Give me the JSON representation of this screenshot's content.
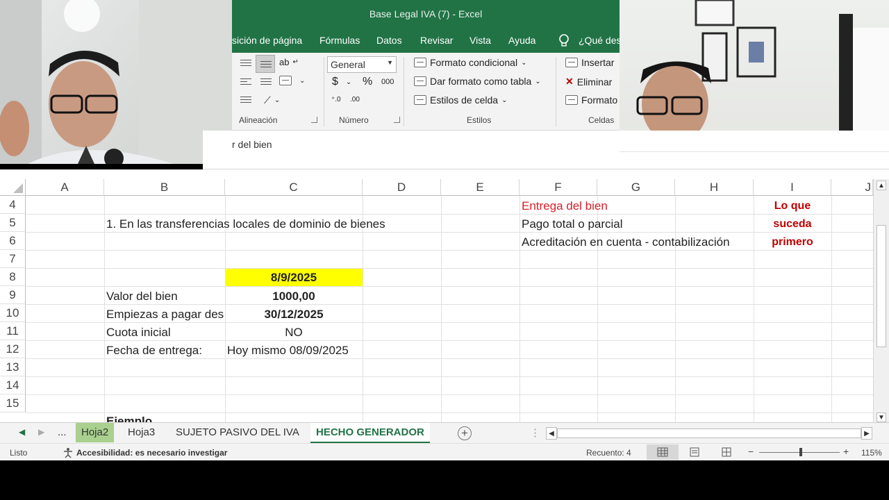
{
  "window": {
    "title": "Base Legal IVA (7)  -  Excel"
  },
  "menu_tabs": [
    "sición de página",
    "Fórmulas",
    "Datos",
    "Revisar",
    "Vista",
    "Ayuda"
  ],
  "tell_me": "¿Qué des",
  "ribbon": {
    "alignment_label": "Alineación",
    "number_label": "Número",
    "number_format": "General",
    "styles_label": "Estilos",
    "cells_label": "Celdas",
    "conditional_format": "Formato condicional",
    "format_as_table": "Dar formato como tabla",
    "cell_styles": "Estilos de celda",
    "insert": "Insertar",
    "delete": "Eliminar",
    "format": "Formato",
    "currency_symbol": "$",
    "percent_symbol": "%",
    "thousands_symbol": "000"
  },
  "formula_bar": {
    "content": "r del bien"
  },
  "columns": [
    "A",
    "B",
    "C",
    "D",
    "E",
    "F",
    "G",
    "H",
    "I",
    "J"
  ],
  "rows": [
    "4",
    "5",
    "6",
    "7",
    "8",
    "9",
    "10",
    "11",
    "12",
    "13",
    "14",
    "15"
  ],
  "cells": {
    "b5": "1. En las transferencias locales de dominio de bienes",
    "f4": "Entrega del bien",
    "f5": "Pago total o parcial",
    "f6": "Acreditación en cuenta - contabilización",
    "i4": "Lo que",
    "i5": "suceda",
    "i6": "primero",
    "c8": "8/9/2025",
    "b9": "Valor del bien",
    "c9": "1000,00",
    "b10": "Empiezas a pagar desde",
    "c10": "30/12/2025",
    "b11": "Cuota inicial",
    "c11": "NO",
    "b12": "Fecha de entrega:",
    "c12": "Hoy mismo 08/09/2025",
    "b16": "Ejemplo"
  },
  "sheets": {
    "ellipsis": "...",
    "tabs": [
      "Hoja2",
      "Hoja3",
      "SUJETO PASIVO DEL IVA",
      "HECHO GENERADOR"
    ],
    "active": "HECHO GENERADOR"
  },
  "status": {
    "ready": "Listo",
    "accessibility": "Accesibilidad: es necesario investigar",
    "count": "Recuento: 4",
    "zoom": "115%"
  },
  "colors": {
    "excel_green": "#217346",
    "highlight_yellow": "#ffff00",
    "red_text": "#d81e2a",
    "dark_red": "#c00000"
  }
}
